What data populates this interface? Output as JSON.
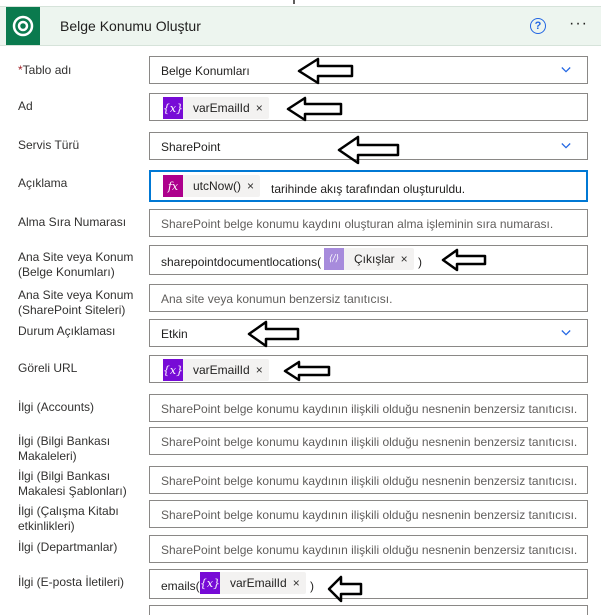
{
  "header": {
    "title": "Belge Konumu Oluştur",
    "help_icon": "?",
    "more_icon": "···"
  },
  "colors": {
    "header_bg": "#edf5ef",
    "app_icon_bg": "#0a7a4e",
    "accent": "#0078d4",
    "variable_token": "#770bd6",
    "expression_token": "#ad008c"
  },
  "fields": {
    "tablo": {
      "required_mark": "*",
      "label": "Tablo adı",
      "value": "Belge Konumları"
    },
    "ad": {
      "label": "Ad",
      "token": "varEmailId",
      "token_x": "×"
    },
    "servis": {
      "label": "Servis Türü",
      "value": "SharePoint"
    },
    "aciklama": {
      "label": "Açıklama",
      "token_icon": "fx",
      "token": "utcNow()",
      "token_x": "×",
      "suffix": "tarihinde akış tarafından oluşturuldu."
    },
    "alma": {
      "label": "Alma Sıra Numarası",
      "placeholder": "SharePoint belge konumu kaydını oluşturan alma işleminin sıra numarası."
    },
    "anasite1": {
      "label": "Ana Site veya Konum (Belge Konumları)",
      "prefix": "sharepointdocumentlocations(",
      "token": "Çıkışlar",
      "token_x": "×",
      "suffix": ")"
    },
    "anasite2": {
      "label": "Ana Site veya Konum (SharePoint Siteleri)",
      "placeholder": "Ana site veya konumun benzersiz tanıtıcısı."
    },
    "durum": {
      "label": "Durum Açıklaması",
      "value": "Etkin"
    },
    "goreli": {
      "label": "Göreli URL",
      "token": "varEmailId",
      "token_x": "×"
    },
    "ilgi_accounts": {
      "label": "İlgi (Accounts)",
      "placeholder": "SharePoint belge konumu kaydının ilişkili olduğu nesnenin benzersiz tanıtıcısı."
    },
    "ilgi_bilgi": {
      "label": "İlgi (Bilgi Bankası Makaleleri)",
      "placeholder": "SharePoint belge konumu kaydının ilişkili olduğu nesnenin benzersiz tanıtıcısı."
    },
    "ilgi_sablon": {
      "label": "İlgi (Bilgi Bankası Makalesi Şablonları)",
      "placeholder": "SharePoint belge konumu kaydının ilişkili olduğu nesnenin benzersiz tanıtıcısı."
    },
    "ilgi_calisma": {
      "label": "İlgi (Çalışma Kitabı etkinlikleri)",
      "placeholder": "SharePoint belge konumu kaydının ilişkili olduğu nesnenin benzersiz tanıtıcısı."
    },
    "ilgi_dept": {
      "label": "İlgi (Departmanlar)",
      "placeholder": "SharePoint belge konumu kaydının ilişkili olduğu nesnenin benzersiz tanıtıcısı."
    },
    "ilgi_eposta": {
      "label": "İlgi (E-posta İletileri)",
      "prefix": "emails(",
      "token": "varEmailId",
      "token_x": "×",
      "suffix": ")"
    }
  },
  "token_icons": {
    "variable": "{x}",
    "output": "⟨/⟩"
  }
}
